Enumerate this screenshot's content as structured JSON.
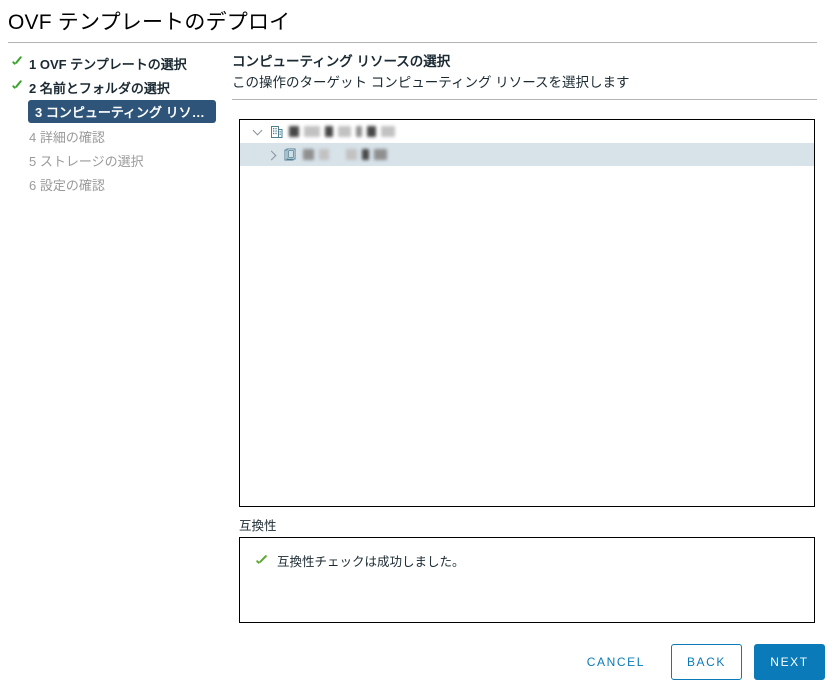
{
  "window": {
    "title": "OVF テンプレートのデプロイ"
  },
  "steps": [
    {
      "number": "1",
      "label": "1 OVF テンプレートの選択",
      "state": "done"
    },
    {
      "number": "2",
      "label": "2 名前とフォルダの選択",
      "state": "done"
    },
    {
      "number": "3",
      "label": "3 コンピューティング リソー...",
      "state": "current"
    },
    {
      "number": "4",
      "label": "4 詳細の確認",
      "state": "upcoming"
    },
    {
      "number": "5",
      "label": "5 ストレージの選択",
      "state": "upcoming"
    },
    {
      "number": "6",
      "label": "6 設定の確認",
      "state": "upcoming"
    }
  ],
  "pane": {
    "heading": "コンピューティング リソースの選択",
    "subheading": "この操作のターゲット コンピューティング リソースを選択します"
  },
  "tree": {
    "nodes": [
      {
        "icon": "datacenter-icon",
        "twisty": "expanded",
        "level": 0,
        "selected": false,
        "label_redacted": true
      },
      {
        "icon": "cluster-icon",
        "twisty": "collapsed",
        "level": 1,
        "selected": true,
        "label_redacted": true
      }
    ]
  },
  "compatibility": {
    "label": "互換性",
    "status_icon": "check-icon",
    "message": "互換性チェックは成功しました。"
  },
  "footer": {
    "cancel_label": "CANCEL",
    "back_label": "BACK",
    "next_label": "NEXT"
  },
  "colors": {
    "accent_blue": "#0b7ab8",
    "current_step_bg": "#2e5579",
    "success_green": "#3fa22f",
    "selection_bg": "#d7e2e9",
    "icon_teal": "#4f7f93"
  }
}
